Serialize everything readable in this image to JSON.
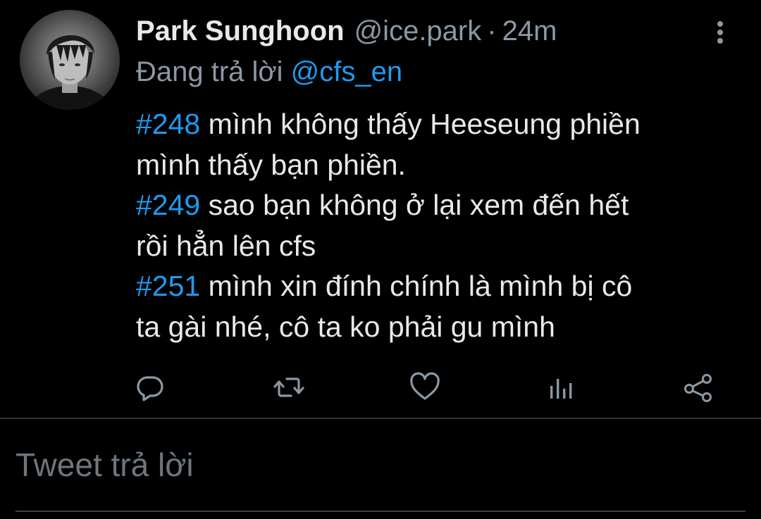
{
  "tweet": {
    "author_name": "Park Sunghoon",
    "handle": "@ice.park",
    "separator": "·",
    "time": "24m",
    "replying_prefix": "Đang trả lời",
    "replying_to": "@cfs_en",
    "lines": [
      {
        "tag": "#248",
        "text": " mình không thấy Heeseung phiền"
      },
      {
        "tag": "",
        "text": "mình thấy bạn phiền."
      },
      {
        "tag": "#249",
        "text": " sao bạn không ở lại xem đến hết"
      },
      {
        "tag": "",
        "text": "rồi hẳn lên cfs"
      },
      {
        "tag": "#251",
        "text": " mình xin đính chính là mình bị cô"
      },
      {
        "tag": "",
        "text": "ta gài nhé, cô ta ko phải gu mình"
      }
    ]
  },
  "actions": [
    {
      "icon": "reply-icon"
    },
    {
      "icon": "retweet-icon"
    },
    {
      "icon": "like-icon"
    },
    {
      "icon": "analytics-icon"
    },
    {
      "icon": "share-icon"
    }
  ],
  "composer": {
    "placeholder": "Tweet trả lời"
  },
  "colors": {
    "background": "#000000",
    "text": "#e7e9ea",
    "muted": "#8b98a5",
    "accent": "#1d9bf0",
    "divider": "#2f3336"
  }
}
